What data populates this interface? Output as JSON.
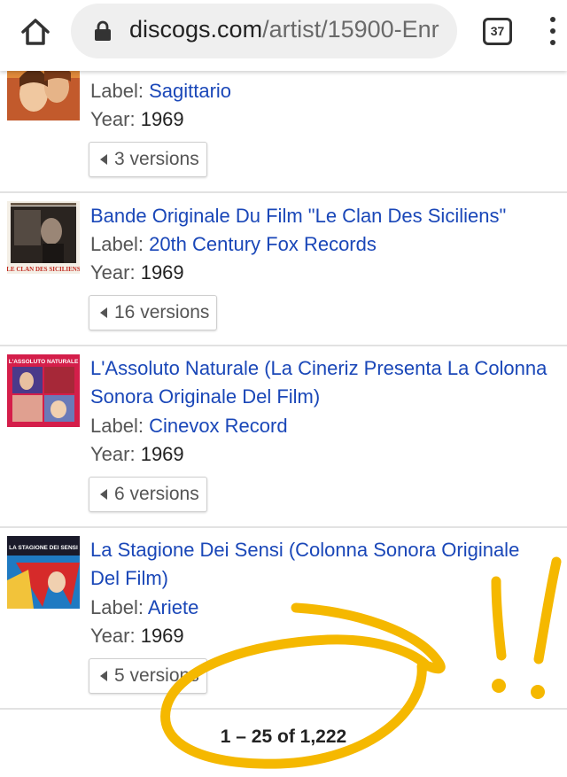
{
  "browser": {
    "url_domain": "discogs.com",
    "url_path": "/artist/15900-Enr",
    "tab_count": "37",
    "icons": {
      "home": "home-icon",
      "lock": "lock-icon",
      "menu": "more-vert-icon"
    }
  },
  "releases": [
    {
      "label_key": "Label:",
      "label": "Sagittario",
      "year_key": "Year:",
      "year": "1969",
      "versions": "3 versions"
    },
    {
      "title": "Bande Originale Du Film \"Le Clan Des Siciliens\"",
      "label_key": "Label:",
      "label": "20th Century Fox Records",
      "year_key": "Year:",
      "year": "1969",
      "versions": "16 versions",
      "cover_text": "LE CLAN DES SICILIENS"
    },
    {
      "title": "L'Assoluto Naturale (La Cineriz Presenta La Colonna Sonora Originale Del Film)",
      "label_key": "Label:",
      "label": "Cinevox Record",
      "year_key": "Year:",
      "year": "1969",
      "versions": "6 versions",
      "cover_text": "L'ASSOLUTO NATURALE"
    },
    {
      "title": "La Stagione Dei Sensi (Colonna Sonora Originale Del Film)",
      "label_key": "Label:",
      "label": "Ariete",
      "year_key": "Year:",
      "year": "1969",
      "versions": "5 versions",
      "cover_text": "LA STAGIONE DEI SENSI"
    }
  ],
  "pagination": {
    "text": "1 – 25 of 1,222"
  },
  "annotation": {
    "color": "#f5b800"
  },
  "colors": {
    "link": "#1a47b8",
    "divider": "#e2e2e2"
  }
}
